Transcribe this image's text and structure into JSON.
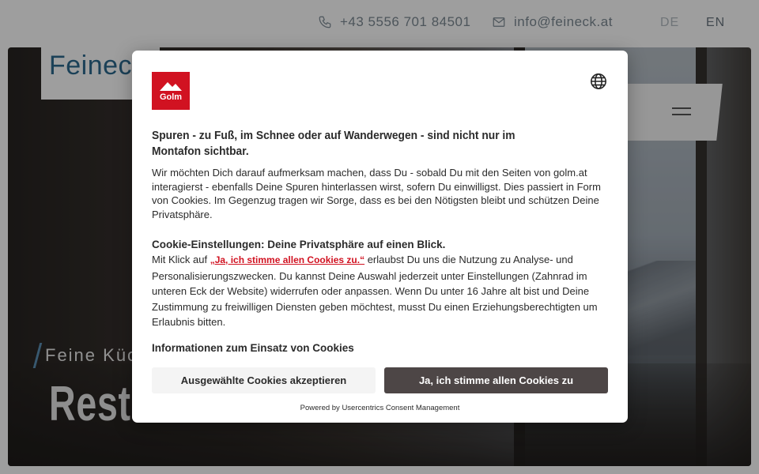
{
  "topbar": {
    "phone": "+43 5556 701 84501",
    "email": "info@feineck.at",
    "lang_de": "DE",
    "lang_en": "EN"
  },
  "hero": {
    "logo": "Feineck",
    "subtitle": "Feine Küche",
    "title": "Restaurant"
  },
  "modal": {
    "brand_logo": "Golm",
    "headline": "Spuren - zu Fuß, im Schnee oder auf Wanderwegen - sind nicht nur im Montafon sichtbar.",
    "intro": "Wir möchten Dich darauf aufmerksam machen, dass Du - sobald Du mit den Seiten von golm.at interagierst - ebenfalls Deine Spuren hinterlassen wirst, sofern Du einwilligst. Dies passiert in Form von Cookies. Im Gegenzug tragen wir Sorge, dass es bei den Nötigsten bleibt und schützen Deine Privatsphäre.",
    "section_title": "Cookie-Einstellungen: Deine Privatsphäre auf einen Blick.",
    "body_prefix": "Mit Klick auf ",
    "body_link": "„Ja, ich stimme allen Cookies zu.“",
    "body_suffix": " erlaubst Du uns die Nutzung zu Analyse- und Personalisierungszwecken. Du kannst Deine Auswahl jederzeit unter Einstellungen (Zahnrad im unteren Eck der Website) widerrufen oder anpassen. Wenn Du unter 16 Jahre alt bist und Deine Zustimmung zu freiwilligen Diensten geben möchtest, musst Du einen Erziehungsberechtigten um Erlaubnis bitten.",
    "info_link": "Informationen zum Einsatz von Cookies",
    "accept_selected": "Ausgewählte Cookies akzeptieren",
    "accept_all": "Ja, ich stimme allen Cookies zu",
    "powered_by": "Powered by Usercentrics Consent Management"
  },
  "colors": {
    "brand_red": "#d11221",
    "primary_button": "#4d4646",
    "secondary_button": "#f4f4f4"
  },
  "icons": [
    "phone-icon",
    "mail-icon",
    "globe-icon",
    "hamburger-menu-icon",
    "golm-mountain-logo"
  ]
}
